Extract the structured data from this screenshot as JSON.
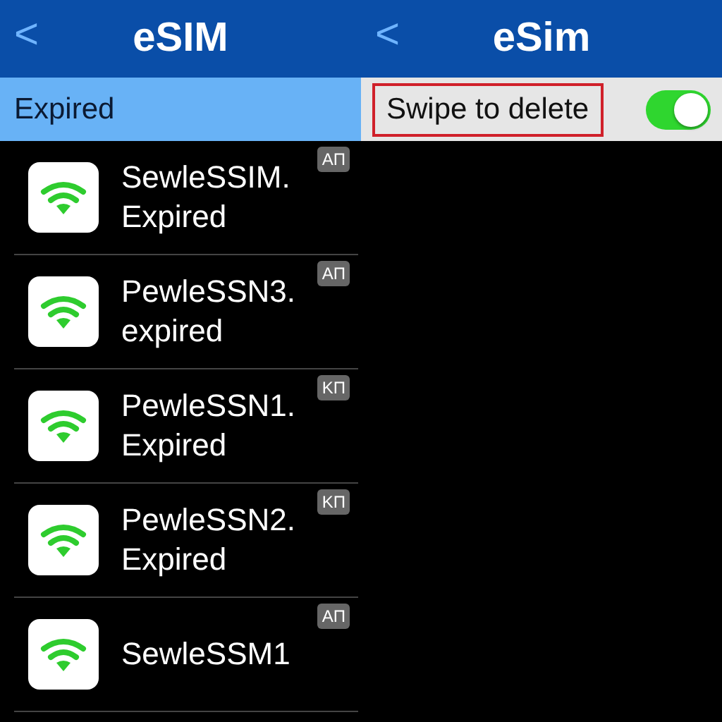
{
  "left_panel": {
    "back": "<",
    "title": "eSIM",
    "section": "Expired",
    "items": [
      {
        "name": "SewleSSIM.",
        "status": "Expired",
        "badge": "AΠ"
      },
      {
        "name": "PewleSSN3.",
        "status": "expired",
        "badge": "AΠ"
      },
      {
        "name": "PewleSSN1.",
        "status": "Expired",
        "badge": "KΠ"
      },
      {
        "name": "PewleSSN2.",
        "status": "Expired",
        "badge": "KΠ"
      },
      {
        "name": "SewleSSM1",
        "badge": "AΠ"
      }
    ]
  },
  "right_panel": {
    "back": "<",
    "title": "eSim",
    "setting": {
      "label": "Swipe to delete",
      "on": true
    }
  }
}
